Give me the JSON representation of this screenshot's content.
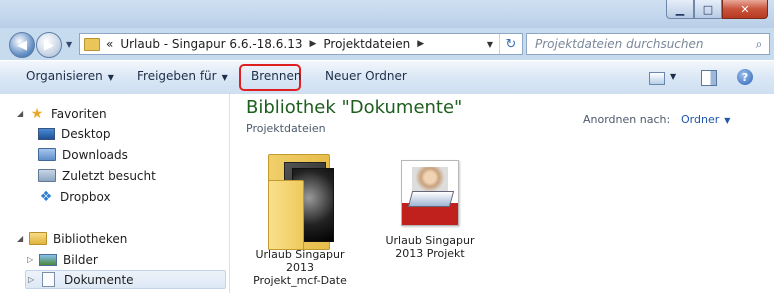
{
  "window": {
    "controls": {
      "minimize_icon": "minimize-icon",
      "maximize_icon": "maximize-icon",
      "close_icon": "close-icon"
    }
  },
  "address": {
    "prefix": "«",
    "crumbs": [
      "Urlaub - Singapur 6.6.-18.6.13",
      "Projektdateien"
    ],
    "search_placeholder": "Projektdateien durchsuchen"
  },
  "toolbar": {
    "organize": "Organisieren",
    "share": "Freigeben für",
    "burn": "Brennen",
    "new_folder": "Neuer Ordner",
    "highlight_color": "#e02020"
  },
  "nav": {
    "favorites": "Favoriten",
    "desktop": "Desktop",
    "downloads": "Downloads",
    "recent": "Zuletzt besucht",
    "dropbox": "Dropbox",
    "libraries": "Bibliotheken",
    "pictures": "Bilder",
    "documents": "Dokumente"
  },
  "main": {
    "library_title": "Bibliothek \"Dokumente\"",
    "library_subtitle": "Projektdateien",
    "arrange_label": "Anordnen nach:",
    "arrange_value": "Ordner",
    "items": [
      {
        "label_lines": [
          "Urlaub Singapur",
          "2013",
          "Projekt_mcf-Date"
        ]
      },
      {
        "label_lines": [
          "Urlaub Singapur",
          "2013 Projekt"
        ]
      }
    ]
  },
  "colors": {
    "title_green": "#1e5e1e",
    "link_blue": "#1f56a8"
  }
}
